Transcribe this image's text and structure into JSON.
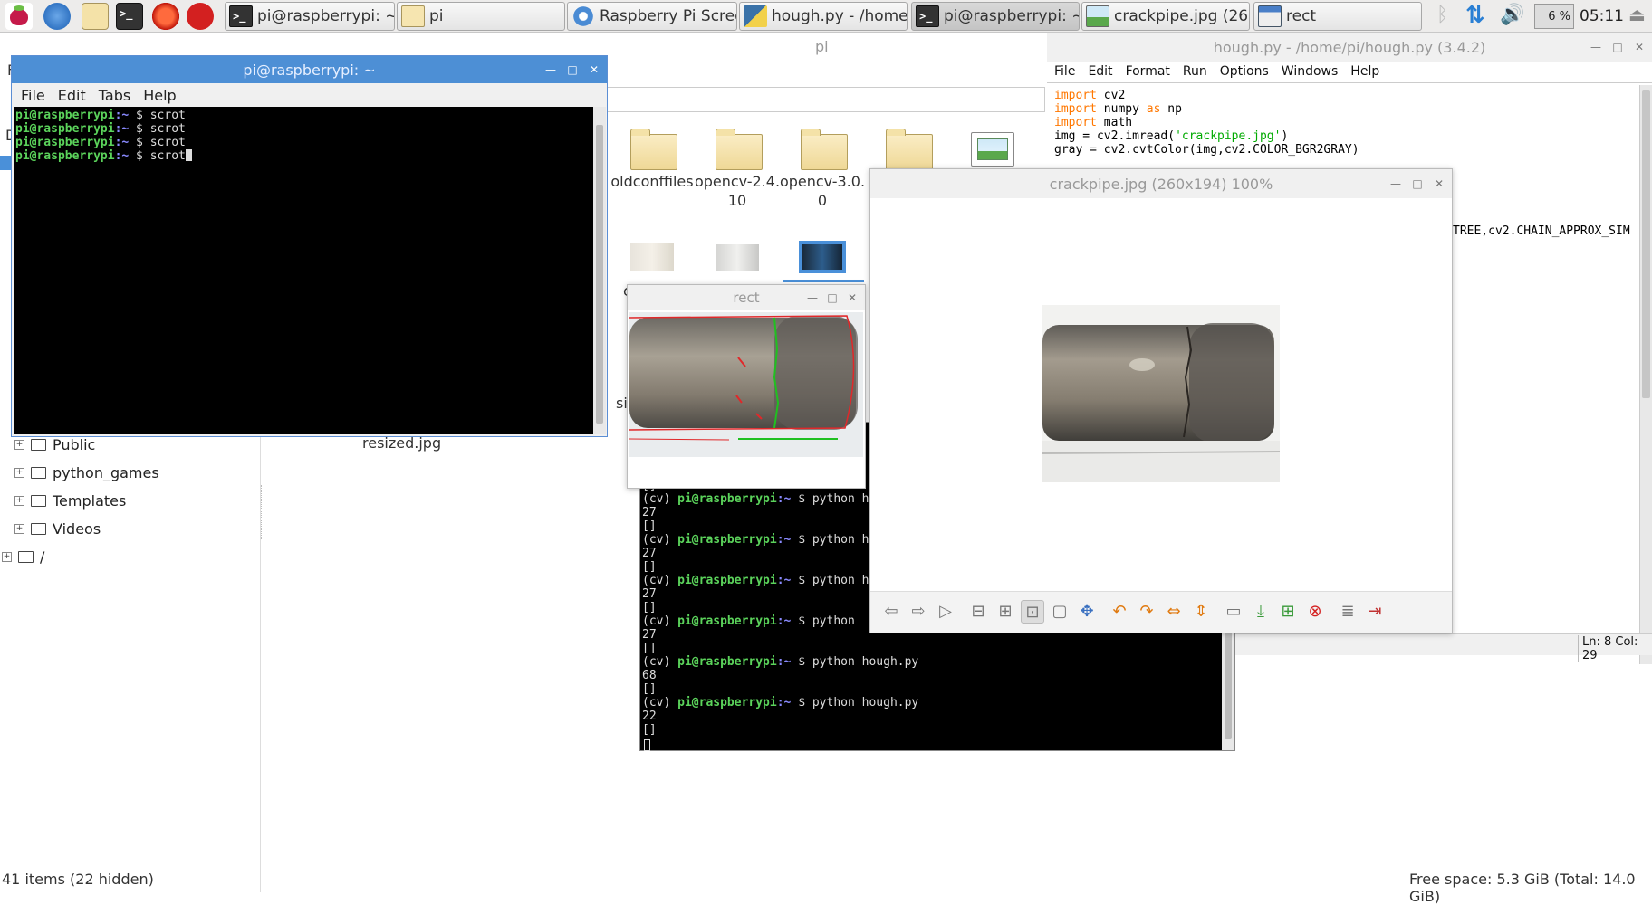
{
  "taskbar": {
    "launchers": [
      "raspberry-menu-icon",
      "web-browser-icon",
      "file-manager-icon",
      "terminal-icon",
      "mathematica-icon",
      "wolfram-icon"
    ],
    "tasks": [
      {
        "label": "pi@raspberrypi: ~",
        "icon": "terminal-icon"
      },
      {
        "label": "pi",
        "icon": "folder-icon"
      },
      {
        "label": "Raspberry Pi Scree...",
        "icon": "chromium-icon"
      },
      {
        "label": "hough.py - /home/...",
        "icon": "python-icon"
      },
      {
        "label": "pi@raspberrypi: ~",
        "icon": "terminal-icon"
      },
      {
        "label": "crackpipe.jpg (260...",
        "icon": "image-icon"
      },
      {
        "label": "rect",
        "icon": "window-icon"
      }
    ],
    "cpu": "6 %",
    "clock": "05:11"
  },
  "file_manager": {
    "title": "pi",
    "first_letter_f": "F",
    "first_letter_d": "D",
    "tree": [
      {
        "label": "Public"
      },
      {
        "label": "python_games"
      },
      {
        "label": "Templates"
      },
      {
        "label": "Videos"
      },
      {
        "label": "/"
      }
    ],
    "icons": [
      {
        "label": "oldconffiles"
      },
      {
        "label": "opencv-2.4.\n10"
      },
      {
        "label": "opencv-3.0.\n0"
      }
    ],
    "partial_c": "c",
    "partial_si": "si",
    "resized_label": "resized.jpg",
    "status_left": "41 items (22 hidden)",
    "status_right": "Free space: 5.3 GiB (Total: 14.0 GiB)"
  },
  "terminal1": {
    "title": "pi@raspberrypi: ~",
    "menu": [
      "File",
      "Edit",
      "Tabs",
      "Help"
    ],
    "lines": [
      {
        "user": "pi@raspberrypi",
        "path": ":~",
        "prompt": " $ ",
        "cmd": "scrot"
      },
      {
        "user": "pi@raspberrypi",
        "path": ":~",
        "prompt": " $ ",
        "cmd": "scrot"
      },
      {
        "user": "pi@raspberrypi",
        "path": ":~",
        "prompt": " $ ",
        "cmd": "scrot"
      },
      {
        "user": "pi@raspberrypi",
        "path": ":~",
        "prompt": " $ ",
        "cmd": "scrot"
      }
    ]
  },
  "terminal2": {
    "lines": [
      {
        "t": "out",
        "text": "[]"
      },
      {
        "t": "prompt",
        "env": "(cv) ",
        "user": "pi@raspberrypi",
        "path": ":~",
        "prompt": " $ ",
        "cmd": "python h"
      },
      {
        "t": "out",
        "text": "27"
      },
      {
        "t": "out",
        "text": "[]"
      },
      {
        "t": "prompt",
        "env": "(cv) ",
        "user": "pi@raspberrypi",
        "path": ":~",
        "prompt": " $ ",
        "cmd": "python h"
      },
      {
        "t": "out",
        "text": "27"
      },
      {
        "t": "out",
        "text": "[]"
      },
      {
        "t": "prompt",
        "env": "(cv) ",
        "user": "pi@raspberrypi",
        "path": ":~",
        "prompt": " $ ",
        "cmd": "python h"
      },
      {
        "t": "out",
        "text": "27"
      },
      {
        "t": "out",
        "text": "[]"
      },
      {
        "t": "prompt",
        "env": "(cv) ",
        "user": "pi@raspberrypi",
        "path": ":~",
        "prompt": " $ ",
        "cmd": "python"
      },
      {
        "t": "out",
        "text": "27"
      },
      {
        "t": "out",
        "text": "[]"
      },
      {
        "t": "prompt",
        "env": "(cv) ",
        "user": "pi@raspberrypi",
        "path": ":~",
        "prompt": " $ ",
        "cmd": "python hough.py"
      },
      {
        "t": "out",
        "text": "68"
      },
      {
        "t": "out",
        "text": "[]"
      },
      {
        "t": "prompt",
        "env": "(cv) ",
        "user": "pi@raspberrypi",
        "path": ":~",
        "prompt": " $ ",
        "cmd": "python hough.py"
      },
      {
        "t": "out",
        "text": "22"
      },
      {
        "t": "out",
        "text": "[]"
      }
    ]
  },
  "idle": {
    "title": "hough.py - /home/pi/hough.py (3.4.2)",
    "menu": [
      "File",
      "Edit",
      "Format",
      "Run",
      "Options",
      "Windows",
      "Help"
    ],
    "code": [
      [
        {
          "k": "import"
        },
        {
          "t": " cv2"
        }
      ],
      [
        {
          "k": "import"
        },
        {
          "t": " numpy "
        },
        {
          "k": "as"
        },
        {
          "t": " np"
        }
      ],
      [
        {
          "k": "import"
        },
        {
          "t": " math"
        }
      ],
      [
        {
          "t": "img = cv2.imread("
        },
        {
          "s": "'crackpipe.jpg'"
        },
        {
          "t": ")"
        }
      ],
      [
        {
          "t": "gray = cv2.cvtColor(img,cv2.COLOR_BGR2GRAY)"
        }
      ]
    ],
    "partial_line": "TREE,cv2.CHAIN_APPROX_SIM",
    "status": "Ln: 8 Col: 29"
  },
  "rect_window": {
    "title": "rect"
  },
  "image_viewer": {
    "title": "crackpipe.jpg (260x194) 100%",
    "toolbar_icons": [
      "prev-icon",
      "next-icon",
      "play-icon",
      "zoom-out-icon",
      "zoom-in-icon",
      "fit-icon",
      "original-size-icon",
      "fullscreen-icon",
      "rotate-left-icon",
      "rotate-right-icon",
      "flip-horizontal-icon",
      "flip-vertical-icon",
      "open-file-icon",
      "save-icon",
      "save-as-icon",
      "delete-icon",
      "preferences-icon",
      "exit-icon"
    ]
  }
}
